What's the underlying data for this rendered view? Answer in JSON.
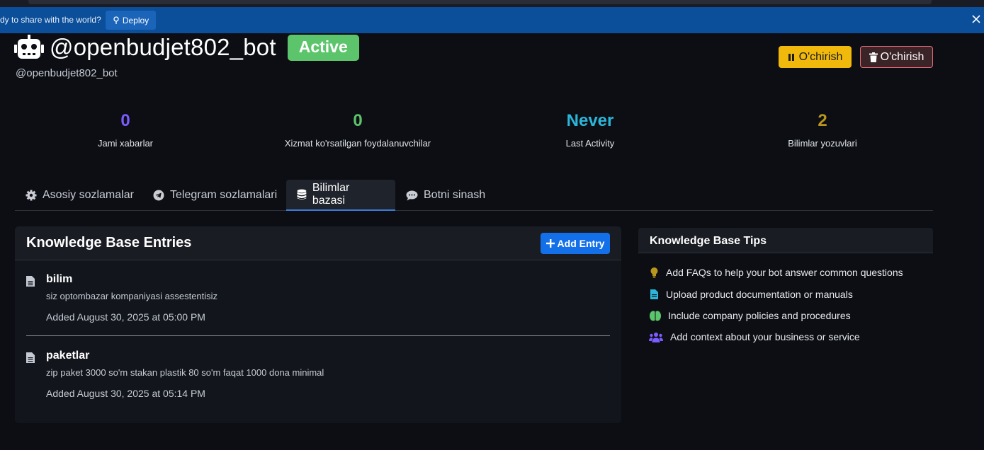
{
  "deploy_bar": {
    "message": "dy to share with the world?",
    "deploy_label": "Deploy"
  },
  "header": {
    "bot_title": "@openbudjet802_bot",
    "status_badge": "Active",
    "username": "@openbudjet802_bot",
    "pause_button": "O'chirish",
    "delete_button": "O'chirish"
  },
  "stats": [
    {
      "value": "0",
      "label": "Jami xabarlar",
      "color": "#7c5cff"
    },
    {
      "value": "0",
      "label": "Xizmat ko'rsatilgan foydalanuvchilar",
      "color": "#5cc46a"
    },
    {
      "value": "Never",
      "label": "Last Activity",
      "color": "#2bb6d9"
    },
    {
      "value": "2",
      "label": "Bilimlar yozuvlari",
      "color": "#b8961c"
    }
  ],
  "tabs": [
    {
      "label": "Asosiy sozlamalar",
      "icon": "gear-icon"
    },
    {
      "label": "Telegram sozlamalari",
      "icon": "telegram-icon"
    },
    {
      "label": "Bilimlar bazasi",
      "icon": "database-icon",
      "active": true
    },
    {
      "label": "Botni sinash",
      "icon": "chat-icon"
    }
  ],
  "knowledge_base": {
    "title": "Knowledge Base Entries",
    "add_button": "Add Entry",
    "entries": [
      {
        "title": "bilim",
        "description": "siz optombazar kompaniyasi assestentisiz",
        "added": "Added August 30, 2025 at 05:00 PM"
      },
      {
        "title": "paketlar",
        "description": "zip paket 3000 so'm stakan plastik 80 so'm faqat 1000 dona minimal",
        "added": "Added August 30, 2025 at 05:14 PM"
      }
    ]
  },
  "tips": {
    "title": "Knowledge Base Tips",
    "items": [
      {
        "text": "Add FAQs to help your bot answer common questions",
        "icon": "lightbulb-icon",
        "color": "#b8961c"
      },
      {
        "text": "Upload product documentation or manuals",
        "icon": "document-icon",
        "color": "#2bb6d9"
      },
      {
        "text": "Include company policies and procedures",
        "icon": "brain-icon",
        "color": "#5cc46a"
      },
      {
        "text": "Add context about your business or service",
        "icon": "users-icon",
        "color": "#7c5cff"
      }
    ]
  }
}
